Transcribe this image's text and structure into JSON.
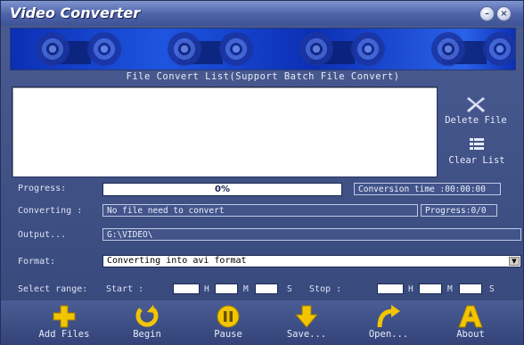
{
  "window": {
    "title": "Video Converter",
    "minimize_glyph": "–",
    "close_glyph": "×"
  },
  "file_list": {
    "caption": "File Convert List(Support Batch File Convert)"
  },
  "side_buttons": {
    "delete_label": "Delete File",
    "clear_label": "Clear List"
  },
  "progress": {
    "label": "Progress:",
    "value_text": "0%",
    "fraction": 0,
    "conversion_time": "Conversion time :00:00:00"
  },
  "converting": {
    "label": "Converting :",
    "status": "No file need to convert",
    "progress_count": "Progress:0/0"
  },
  "output": {
    "label": "Output...",
    "path": "G:\\VIDEO\\"
  },
  "format": {
    "label": "Format:",
    "selected": "Converting into avi format",
    "arrow_glyph": "▼"
  },
  "range": {
    "label": "Select range:",
    "start_label": "Start :",
    "stop_label": "Stop :",
    "h": "H",
    "m": "M",
    "s": "S",
    "start_h": "",
    "start_m": "",
    "start_s": "",
    "stop_h": "",
    "stop_m": "",
    "stop_s": ""
  },
  "toolbar": {
    "add_files": "Add Files",
    "begin": "Begin",
    "pause": "Pause",
    "save": "Save...",
    "open": "Open...",
    "about": "About"
  },
  "colors": {
    "accent": "#3c4e82",
    "icon_yellow": "#f2c500"
  }
}
